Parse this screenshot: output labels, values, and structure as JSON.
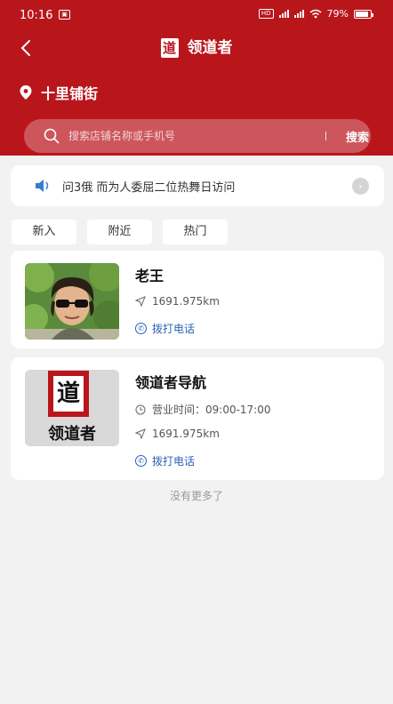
{
  "status_bar": {
    "time": "10:16",
    "battery": "79%"
  },
  "header": {
    "title": "领道者",
    "logo_char": "道"
  },
  "location": {
    "name": "十里铺街"
  },
  "search": {
    "placeholder": "搜索店铺名称或手机号",
    "button": "搜索"
  },
  "notice": {
    "text": "问3俄 而为人委屈二位热舞日访问"
  },
  "tabs": [
    "新入",
    "附近",
    "热门"
  ],
  "stores": [
    {
      "name": "老王",
      "distance": "1691.975km",
      "call": "拨打电话"
    },
    {
      "name": "领道者导航",
      "hours": "营业时间：09:00-17:00",
      "distance": "1691.975km",
      "call": "拨打电话",
      "logo_char": "道",
      "logo_label": "领道者"
    }
  ],
  "footer": {
    "no_more": "没有更多了"
  },
  "colors": {
    "brand_red": "#b9161c",
    "link_blue": "#2b61b5"
  }
}
